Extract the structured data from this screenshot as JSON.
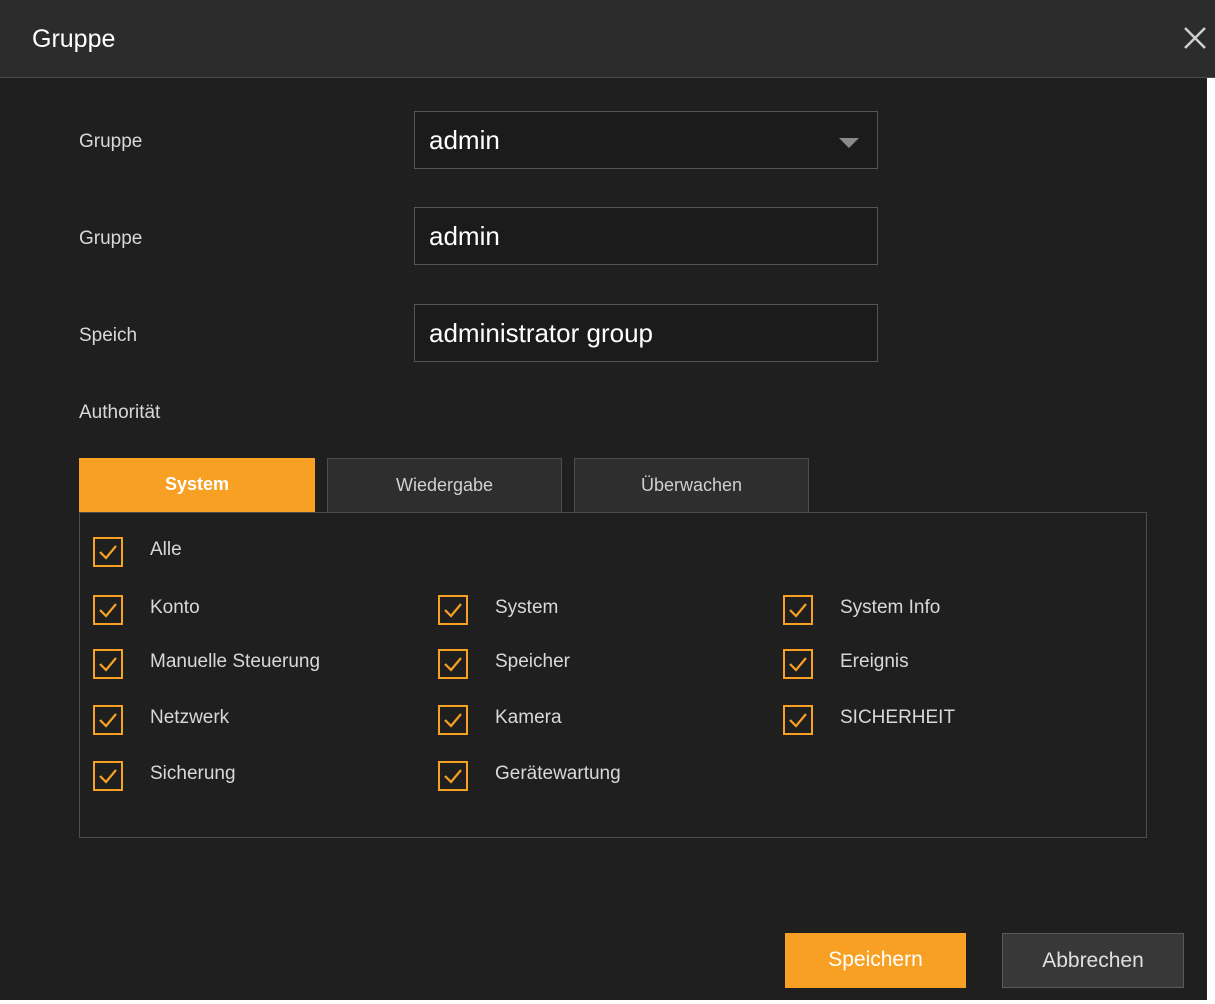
{
  "dialog": {
    "title": "Gruppe",
    "close_icon": "close-icon"
  },
  "form": {
    "group_select": {
      "label": "Gruppe",
      "value": "admin"
    },
    "group_name": {
      "label": "Gruppe",
      "value": "admin"
    },
    "memo": {
      "label": "Speich",
      "value": "administrator group"
    }
  },
  "authority": {
    "label": "Authorität",
    "tabs": [
      {
        "label": "System",
        "active": true
      },
      {
        "label": "Wiedergabe",
        "active": false
      },
      {
        "label": "Überwachen",
        "active": false
      }
    ],
    "all": {
      "label": "Alle",
      "checked": true
    },
    "permissions": [
      {
        "label": "Konto",
        "checked": true
      },
      {
        "label": "System",
        "checked": true
      },
      {
        "label": "System Info",
        "checked": true
      },
      {
        "label": "Manuelle Steuerung",
        "checked": true
      },
      {
        "label": "Speicher",
        "checked": true
      },
      {
        "label": "Ereignis",
        "checked": true
      },
      {
        "label": "Netzwerk",
        "checked": true
      },
      {
        "label": "Kamera",
        "checked": true
      },
      {
        "label": "SICHERHEIT",
        "checked": true
      },
      {
        "label": "Sicherung",
        "checked": true
      },
      {
        "label": "Gerätewartung",
        "checked": true
      }
    ]
  },
  "buttons": {
    "save": "Speichern",
    "cancel": "Abbrechen"
  },
  "colors": {
    "accent": "#f7a024",
    "background": "#1f1f1f",
    "titlebar": "#2c2c2c"
  }
}
